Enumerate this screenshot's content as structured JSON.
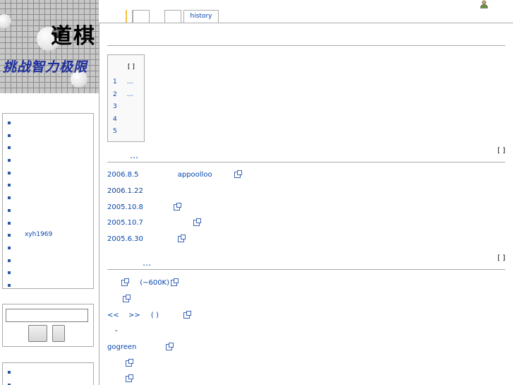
{
  "logo": {
    "title_glyphs": "道棋",
    "motto": "挑战智力极限"
  },
  "tabs": {
    "article": "",
    "discussion": "",
    "edit": "",
    "history": "history"
  },
  "sidebar": {
    "navigation": [
      "",
      "",
      "",
      "",
      "",
      "",
      "",
      "",
      "",
      "xyh1969",
      "",
      "",
      "",
      ""
    ],
    "toolbox": [
      "",
      ""
    ]
  },
  "search": {
    "value": "",
    "go_label": "",
    "fulltext_label": ""
  },
  "toc": {
    "title": "[ ]",
    "items": [
      {
        "number": "1",
        "text": "…"
      },
      {
        "number": "2",
        "text": "…"
      },
      {
        "number": "3",
        "text": ""
      },
      {
        "number": "4",
        "text": ""
      },
      {
        "number": "5",
        "text": ""
      }
    ]
  },
  "sections": [
    {
      "heading": "…",
      "edit_label": "[ ]"
    },
    {
      "heading": "…",
      "edit_label": "[ ]"
    }
  ],
  "news": [
    {
      "date": "2006.8.5",
      "text": "appoolloo",
      "external": true
    },
    {
      "date": "2006.1.22",
      "text": "",
      "external": false
    },
    {
      "date": "2005.10.8",
      "text": "",
      "external": true
    },
    {
      "date": "2005.10.7",
      "text": "",
      "external": true
    },
    {
      "date": "2005.6.30",
      "text": "",
      "external": true
    }
  ],
  "resources": {
    "download_size": "(~600K)",
    "nav_prev": "<<",
    "nav_next": ">>",
    "nav_paren": "( )",
    "dash": "-",
    "gogreen": "gogreen"
  },
  "colors": {
    "link": "#0645ad",
    "border": "#aaaaaa",
    "motto": "#1e2f9c",
    "active_tab_marker": "#f5c242"
  }
}
